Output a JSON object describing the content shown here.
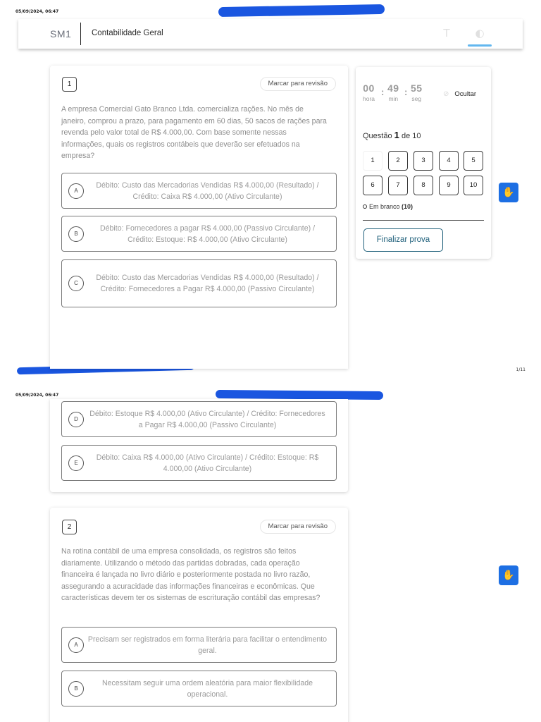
{
  "print_header": {
    "datetime": "05/09/2024, 06:47",
    "page_number": "1/11"
  },
  "header": {
    "logo": "SM1",
    "course_title": "Contabilidade Geral",
    "font_icon": "T",
    "contrast_icon": "◐"
  },
  "questions": [
    {
      "number": "1",
      "review_label": "Marcar para revisão",
      "statement": "A empresa Comercial Gato Branco Ltda. comercializa rações. No mês de janeiro, comprou a prazo, para pagamento em 60 dias, 50 sacos de rações para revenda pelo valor total de R$ 4.000,00. Com base somente nessas informações, quais os registros contábeis que deverão ser efetuados na empresa?",
      "options": [
        {
          "letter": "A",
          "text": "Débito: Custo das Mercadorias Vendidas R$ 4.000,00 (Resultado)  /  Crédito: Caixa R$ 4.000,00 (Ativo Circulante)"
        },
        {
          "letter": "B",
          "text": "Débito: Fornecedores a pagar R$ 4.000,00 (Passivo Circulante)  /  Crédito: Estoque: R$ 4.000,00 (Ativo Circulante)"
        },
        {
          "letter": "C",
          "text": "Débito: Custo das Mercadorias Vendidas R$ 4.000,00 (Resultado)  /  Crédito: Fornecedores a Pagar R$ 4.000,00 (Passivo Circulante)"
        },
        {
          "letter": "D",
          "text": "Débito: Estoque R$ 4.000,00 (Ativo Circulante)  /  Crédito: Fornecedores a Pagar R$ 4.000,00 (Passivo Circulante)"
        },
        {
          "letter": "E",
          "text": "Débito: Caixa R$ 4.000,00 (Ativo Circulante)  /  Crédito: Estoque: R$ 4.000,00 (Ativo Circulante)"
        }
      ]
    },
    {
      "number": "2",
      "review_label": "Marcar para revisão",
      "statement": "Na rotina contábil de uma empresa consolidada, os registros são feitos diariamente. Utilizando o método das partidas dobradas, cada operação financeira é lançada no livro diário e posteriormente postada no livro razão, assegurando a acuracidade das informações financeiras e econômicas. Que características devem ter os sistemas de escrituração contábil das empresas?",
      "options": [
        {
          "letter": "A",
          "text": "Precisam ser registrados em forma literária para facilitar o entendimento geral."
        },
        {
          "letter": "B",
          "text": "Necessitam seguir uma ordem aleatória para maior flexibilidade operacional."
        }
      ]
    }
  ],
  "timer": {
    "hours": "00",
    "minutes": "49",
    "seconds": "55",
    "hours_label": "hora",
    "minutes_label": "min",
    "seconds_label": "seg",
    "separator": ":",
    "hide_label": "Ocultar"
  },
  "navigator": {
    "question_prefix": "Questão",
    "current": "1",
    "of_label": "de 10",
    "buttons": [
      "1",
      "2",
      "3",
      "4",
      "5",
      "6",
      "7",
      "8",
      "9",
      "10"
    ],
    "blank_label": "Em branco",
    "blank_count": "(10)",
    "finish_label": "Finalizar prova"
  },
  "accessibility": {
    "icon": "accessibility-hand-icon",
    "glyph": "✋"
  },
  "colors": {
    "accent": "#1e5f7a",
    "a11y_blue": "#1d6fe3",
    "redaction": "#1a56e0",
    "tab_underline": "#62b7ef"
  }
}
